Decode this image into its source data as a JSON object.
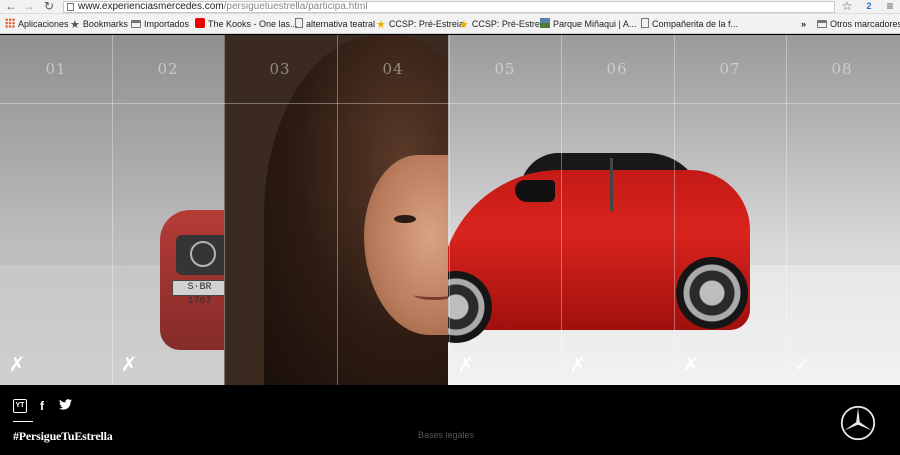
{
  "browser": {
    "url_domain": "www.experienciasmercedes.com",
    "url_path": "/persiguetuestrella/participa.html",
    "extension_badge": "2",
    "nav": {
      "back": "←",
      "forward": "→",
      "reload": "↻"
    },
    "star": "☆",
    "menu": "≡"
  },
  "bookmarks": {
    "items": [
      {
        "label": "Aplicaciones",
        "icon": "apps-grid-icon"
      },
      {
        "label": "Bookmarks",
        "icon": "star-icon"
      },
      {
        "label": "Importados",
        "icon": "folder-icon"
      },
      {
        "label": "The Kooks - One las...",
        "icon": "youtube-icon"
      },
      {
        "label": "alternativa teatral",
        "icon": "page-icon"
      },
      {
        "label": "CCSP: Pré-Estreia",
        "icon": "star-icon"
      },
      {
        "label": "CCSP: Pré-Estreia",
        "icon": "star-icon"
      },
      {
        "label": "Parque Miñaqui | A...",
        "icon": "image-icon"
      },
      {
        "label": "Compañerita de la f...",
        "icon": "page-icon"
      }
    ],
    "overflow": "»",
    "other": "Otros marcadores"
  },
  "stage": {
    "columns": [
      "01",
      "02",
      "03",
      "04",
      "05",
      "06",
      "07",
      "08"
    ],
    "marks": [
      {
        "col": 1,
        "symbol": "✗",
        "state": "wrong"
      },
      {
        "col": 2,
        "symbol": "✗",
        "state": "wrong"
      },
      {
        "col": 5,
        "symbol": "✗",
        "state": "wrong"
      },
      {
        "col": 6,
        "symbol": "✗",
        "state": "wrong"
      },
      {
        "col": 7,
        "symbol": "✗",
        "state": "wrong"
      },
      {
        "col": 8,
        "symbol": "✓",
        "state": "correct"
      }
    ],
    "plate": "S·BR 1767"
  },
  "footer": {
    "hashtag": "#PersigueTuEstrella",
    "legal": "Bases legales",
    "social": [
      "youtube-icon",
      "facebook-icon",
      "twitter-icon"
    ]
  }
}
